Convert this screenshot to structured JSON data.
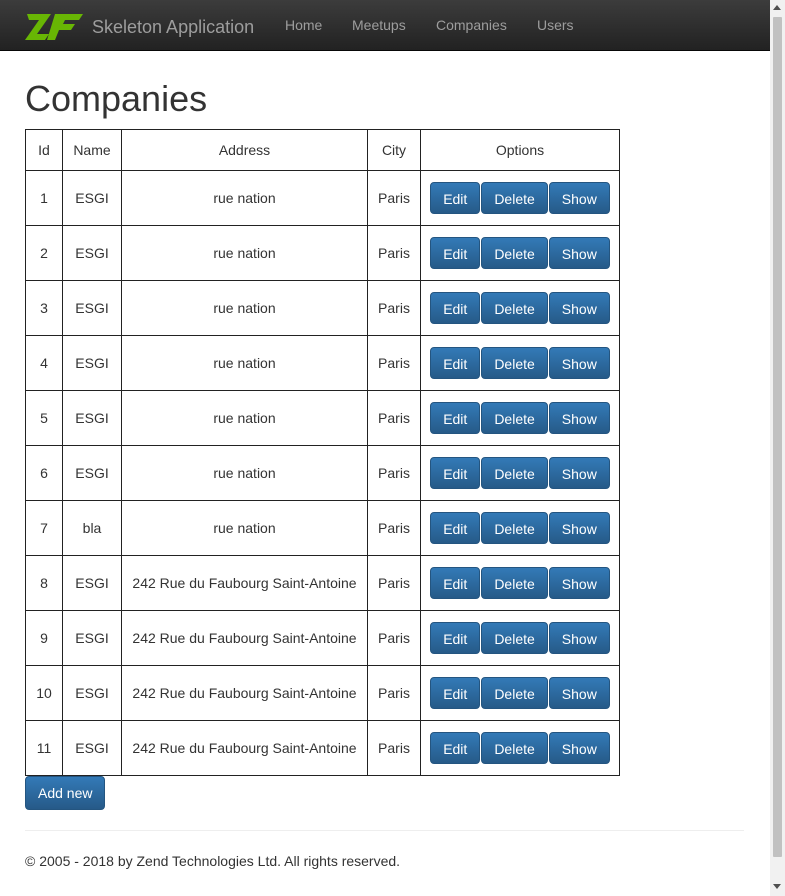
{
  "brand": {
    "name": "Skeleton Application",
    "logo_text": "ZF",
    "logo_color": "#68b604"
  },
  "nav": [
    {
      "label": "Home"
    },
    {
      "label": "Meetups"
    },
    {
      "label": "Companies"
    },
    {
      "label": "Users"
    }
  ],
  "page": {
    "title": "Companies"
  },
  "table": {
    "headers": {
      "id": "Id",
      "name": "Name",
      "address": "Address",
      "city": "City",
      "options": "Options"
    },
    "rows": [
      {
        "id": "1",
        "name": "ESGI",
        "address": "rue nation",
        "city": "Paris"
      },
      {
        "id": "2",
        "name": "ESGI",
        "address": "rue nation",
        "city": "Paris"
      },
      {
        "id": "3",
        "name": "ESGI",
        "address": "rue nation",
        "city": "Paris"
      },
      {
        "id": "4",
        "name": "ESGI",
        "address": "rue nation",
        "city": "Paris"
      },
      {
        "id": "5",
        "name": "ESGI",
        "address": "rue nation",
        "city": "Paris"
      },
      {
        "id": "6",
        "name": "ESGI",
        "address": "rue nation",
        "city": "Paris"
      },
      {
        "id": "7",
        "name": "bla",
        "address": "rue nation",
        "city": "Paris"
      },
      {
        "id": "8",
        "name": "ESGI",
        "address": "242 Rue du Faubourg Saint-Antoine",
        "city": "Paris"
      },
      {
        "id": "9",
        "name": "ESGI",
        "address": "242 Rue du Faubourg Saint-Antoine",
        "city": "Paris"
      },
      {
        "id": "10",
        "name": "ESGI",
        "address": "242 Rue du Faubourg Saint-Antoine",
        "city": "Paris"
      },
      {
        "id": "11",
        "name": "ESGI",
        "address": "242 Rue du Faubourg Saint-Antoine",
        "city": "Paris"
      }
    ],
    "actions": {
      "edit": "Edit",
      "delete": "Delete",
      "show": "Show"
    }
  },
  "add_new_label": "Add new",
  "footer": {
    "text": "© 2005 - 2018 by Zend Technologies Ltd. All rights reserved."
  },
  "colors": {
    "navbar": "#222222",
    "button": "#337ab7",
    "nav_text": "#9d9d9d"
  }
}
